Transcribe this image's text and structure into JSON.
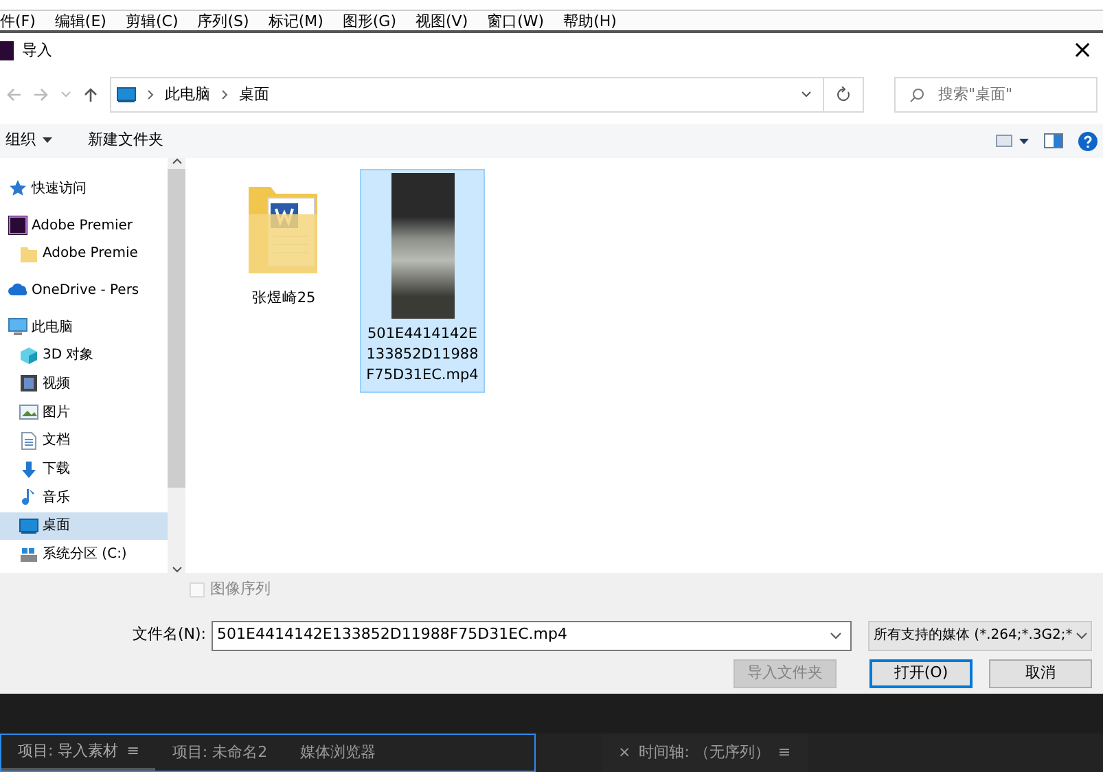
{
  "app_menu": [
    {
      "label": "件(F)"
    },
    {
      "label": "编辑(E)"
    },
    {
      "label": "剪辑(C)"
    },
    {
      "label": "序列(S)"
    },
    {
      "label": "标记(M)"
    },
    {
      "label": "图形(G)"
    },
    {
      "label": "视图(V)"
    },
    {
      "label": "窗口(W)"
    },
    {
      "label": "帮助(H)"
    }
  ],
  "dialog": {
    "title": "导入",
    "close": "×"
  },
  "address": {
    "breadcrumb": [
      "此电脑",
      "桌面"
    ],
    "search": {
      "placeholder": "搜索\"桌面\""
    }
  },
  "toolbar": [
    {
      "label": "组织",
      "dropdown": true
    },
    {
      "label": "新建文件夹",
      "dropdown": false
    }
  ],
  "sidebar": [
    {
      "kind": "star",
      "label": "快速访问",
      "selected": false
    },
    {
      "kind": "premiere",
      "label": "Adobe Premier",
      "selected": false,
      "children": [
        {
          "kind": "folder",
          "label": "Adobe Premie",
          "selected": false
        }
      ]
    },
    {
      "kind": "cloud",
      "label": "OneDrive - Pers",
      "selected": false
    },
    {
      "kind": "pc",
      "label": "此电脑",
      "selected": false,
      "children": [
        {
          "kind": "cube",
          "label": "3D 对象",
          "selected": false
        },
        {
          "kind": "film",
          "label": "视频",
          "selected": false
        },
        {
          "kind": "picture",
          "label": "图片",
          "selected": false
        },
        {
          "kind": "document",
          "label": "文档",
          "selected": false
        },
        {
          "kind": "download",
          "label": "下载",
          "selected": false
        },
        {
          "kind": "music",
          "label": "音乐",
          "selected": false
        },
        {
          "kind": "desktop",
          "label": "桌面",
          "selected": true
        },
        {
          "kind": "drive",
          "label": "系统分区 (C:)",
          "selected": false
        }
      ]
    }
  ],
  "files": [
    {
      "kind": "folder",
      "name": "张煜崎25",
      "selected": false
    },
    {
      "kind": "video",
      "name": "501E4414142E133852D11988F75D31EC.mp4",
      "selected": true
    }
  ],
  "image_sequence": {
    "label": "图像序列",
    "checked": false,
    "disabled": true
  },
  "filename": {
    "label": "文件名(N):",
    "value": "501E4414142E133852D11988F75D31EC.mp4"
  },
  "filter": {
    "value": "所有支持的媒体 (*.264;*.3G2;*"
  },
  "buttons": [
    {
      "label": "导入文件夹",
      "disabled": true,
      "default": false
    },
    {
      "label": "打开(O)",
      "disabled": false,
      "default": true
    },
    {
      "label": "取消",
      "disabled": false,
      "default": false
    }
  ],
  "panels": [
    {
      "label": "项目: 导入素材",
      "selected": true,
      "close": false,
      "menu": "≡"
    },
    {
      "label": "项目: 未命名2",
      "selected": false,
      "close": false
    },
    {
      "label": "媒体浏览器",
      "selected": false,
      "close": false
    },
    {
      "label": "时间轴: （无序列）",
      "selected": false,
      "close": true,
      "close_glyph": "×",
      "menu": "≡"
    }
  ]
}
